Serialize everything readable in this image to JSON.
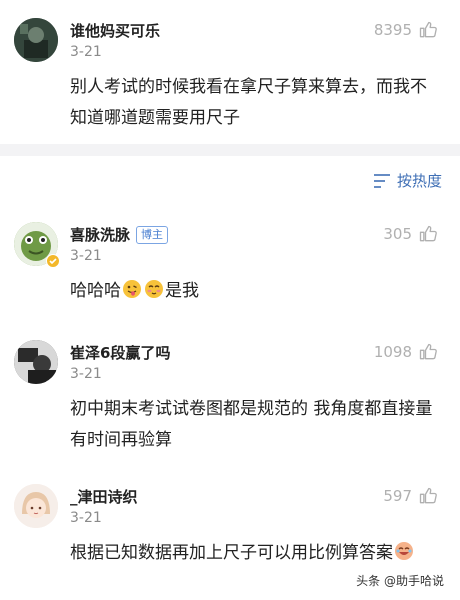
{
  "comments": [
    {
      "username": "谁他妈买可乐",
      "date": "3-21",
      "likes": "8395",
      "text": "别人考试的时候我看在拿尺子算来算去，而我不知道哪道题需要用尺子"
    },
    {
      "username": "喜脉洗脉",
      "badge": "博主",
      "date": "3-21",
      "likes": "305",
      "text_prefix": "哈哈哈",
      "text_suffix": "是我"
    },
    {
      "username": "崔泽6段赢了吗",
      "date": "3-21",
      "likes": "1098",
      "text": "初中期末考试试卷图都是规范的 我角度都直接量 有时间再验算"
    },
    {
      "username": "_津田诗织",
      "date": "3-21",
      "likes": "597",
      "text": "根据已知数据再加上尺子可以用比例算答案"
    }
  ],
  "sort": {
    "label": "按热度",
    "icon": "sort-lines-icon"
  },
  "watermark": "头条 @助手哈说",
  "colors": {
    "link_blue": "#3f6fb5",
    "separator": "#f3f3f5",
    "muted": "#8a8a8a"
  }
}
